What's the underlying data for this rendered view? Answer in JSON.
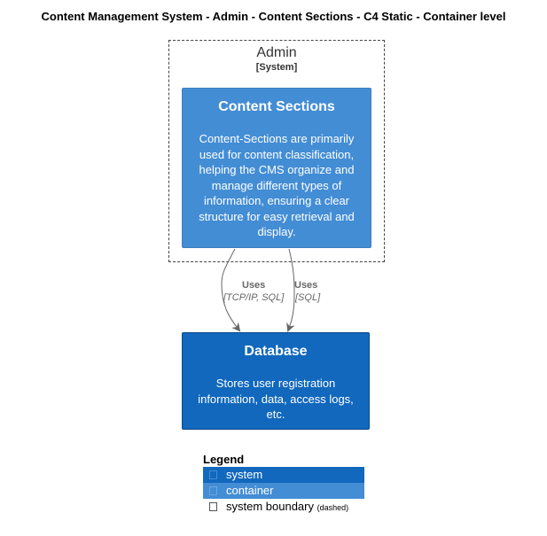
{
  "title": "Content Management System - Admin - Content Sections - C4 Static - Container level",
  "boundary": {
    "name": "Admin",
    "type": "[System]"
  },
  "container": {
    "name": "Content Sections",
    "description": "Content-Sections are primarily used for content classification, helping the CMS organize and manage different types of information, ensuring a clear structure for easy retrieval and display."
  },
  "system": {
    "name": "Database",
    "description": "Stores user registration information, data, access logs, etc."
  },
  "relationships": [
    {
      "label": "Uses",
      "technology": "[TCP/IP, SQL]"
    },
    {
      "label": "Uses",
      "technology": "[SQL]"
    }
  ],
  "legend": {
    "title": "Legend",
    "items": [
      {
        "label": "system",
        "note": "",
        "color": "#1168bd"
      },
      {
        "label": "container",
        "note": "",
        "color": "#438dd5"
      },
      {
        "label": "system boundary",
        "note": "(dashed)",
        "color": "#ffffff"
      }
    ]
  },
  "colors": {
    "system": "#1168bd",
    "container": "#438dd5",
    "arrow": "#666666"
  }
}
